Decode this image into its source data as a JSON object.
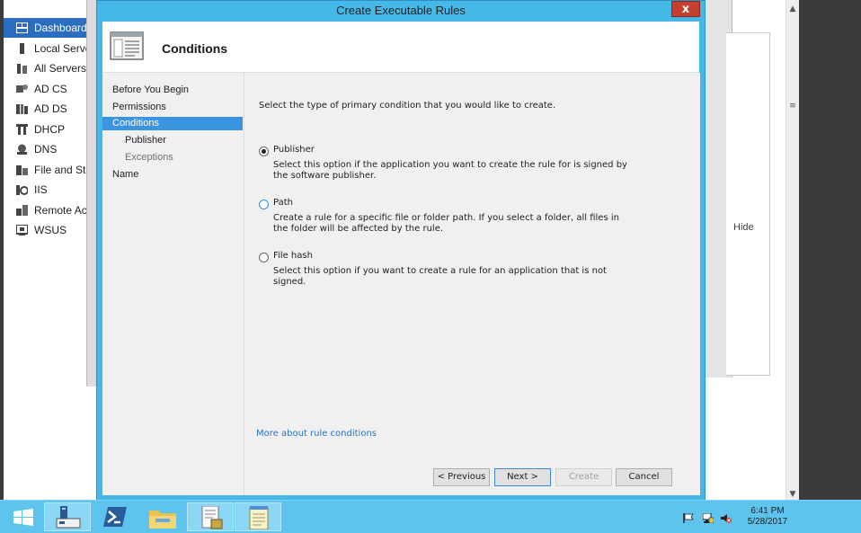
{
  "server_manager": {
    "nav_items": [
      {
        "label": "Dashboard",
        "icon": "dashboard-icon",
        "selected": true
      },
      {
        "label": "Local Server",
        "icon": "local-server-icon"
      },
      {
        "label": "All Servers",
        "icon": "all-servers-icon"
      },
      {
        "label": "AD CS",
        "icon": "ad-cs-icon"
      },
      {
        "label": "AD DS",
        "icon": "ad-ds-icon"
      },
      {
        "label": "DHCP",
        "icon": "dhcp-icon"
      },
      {
        "label": "DNS",
        "icon": "dns-icon"
      },
      {
        "label": "File and Storage Services",
        "icon": "file-storage-icon"
      },
      {
        "label": "IIS",
        "icon": "iis-icon"
      },
      {
        "label": "Remote Access",
        "icon": "remote-access-icon"
      },
      {
        "label": "WSUS",
        "icon": "wsus-icon"
      }
    ],
    "hide_label": "Hide"
  },
  "dialog": {
    "title": "Create Executable Rules",
    "close_label": "x",
    "header_title": "Conditions",
    "steps": [
      {
        "label": "Before You Begin"
      },
      {
        "label": "Permissions"
      },
      {
        "label": "Conditions",
        "selected": true
      },
      {
        "label": "Publisher",
        "sub": true
      },
      {
        "label": "Exceptions",
        "sub": true,
        "dim": true
      },
      {
        "label": "Name"
      }
    ],
    "prompt": "Select the type of primary condition that you would like to create.",
    "options": [
      {
        "label": "Publisher",
        "description": "Select this option if the application you want to create the rule for is signed by the software publisher.",
        "checked": true
      },
      {
        "label": "Path",
        "description": "Create a rule for a specific file or folder path. If you select a folder, all files in the folder will be affected by the rule.",
        "checked": false
      },
      {
        "label": "File hash",
        "description": "Select this option if you want to create a rule for an application that is not signed.",
        "checked": false
      }
    ],
    "more_link": "More about rule conditions",
    "buttons": {
      "previous": "< Previous",
      "next": "Next >",
      "create": "Create",
      "cancel": "Cancel"
    }
  },
  "taskbar": {
    "apps": [
      {
        "icon": "server-manager-icon",
        "active": true
      },
      {
        "icon": "powershell-icon"
      },
      {
        "icon": "file-explorer-icon"
      },
      {
        "icon": "local-security-policy-icon",
        "active": true
      },
      {
        "icon": "notepad-icon",
        "active": true
      }
    ],
    "time": "6:41 PM",
    "date": "5/28/2017"
  },
  "colors": {
    "accent": "#45b8e8",
    "selection": "#3b94e0",
    "nav_selection": "#2b6ec1",
    "link": "#2e6fc0",
    "close": "#c7402f"
  }
}
